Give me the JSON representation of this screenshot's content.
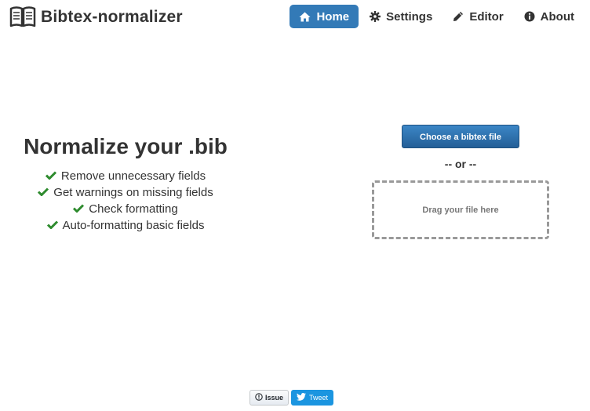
{
  "app": {
    "title": "Bibtex-normalizer",
    "logo_icon": "book-open-icon"
  },
  "nav": {
    "items": [
      {
        "label": "Home",
        "icon": "home-icon",
        "active": true
      },
      {
        "label": "Settings",
        "icon": "gear-icon",
        "active": false
      },
      {
        "label": "Editor",
        "icon": "pencil-icon",
        "active": false
      },
      {
        "label": "About",
        "icon": "info-icon",
        "active": false
      }
    ]
  },
  "hero": {
    "title": "Normalize your .bib",
    "features": [
      "Remove unnecessary fields",
      "Get warnings on missing fields",
      "Check formatting",
      "Auto-formatting basic fields"
    ]
  },
  "upload": {
    "choose_label": "Choose a bibtex file",
    "or_label": "-- or --",
    "dropzone_label": "Drag your file here"
  },
  "footer": {
    "issue_label": "Issue",
    "tweet_label": "Tweet"
  },
  "colors": {
    "accent": "#337ab7",
    "check": "#2e8b2e",
    "tweet": "#1b95e0"
  }
}
